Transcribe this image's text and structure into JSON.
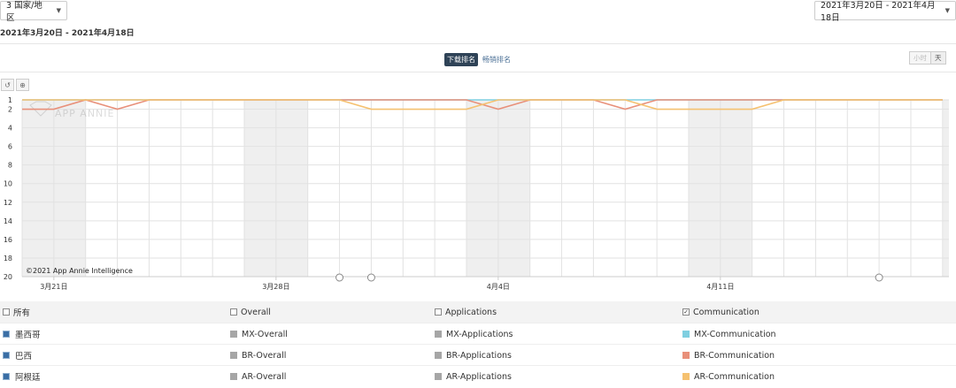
{
  "header": {
    "country_selector": "3 国家/地区",
    "date_range_selector": "2021年3月20日 - 2021年4月18日",
    "date_range_text": "2021年3月20日 - 2021年4月18日"
  },
  "metrics": {
    "download_rank": "下载排名",
    "revenue_rank": "畅销排名"
  },
  "granularity": {
    "hour": "小时",
    "day": "天"
  },
  "chart_data": {
    "type": "line",
    "watermark": "APP ANNIE",
    "copyright": "©2021 App Annie Intelligence",
    "y_ticks": [
      1,
      2,
      4,
      6,
      8,
      10,
      12,
      14,
      16,
      18,
      20
    ],
    "ylim": [
      1,
      20
    ],
    "y_inverted": true,
    "x": [
      "3/20",
      "3/21",
      "3/22",
      "3/23",
      "3/24",
      "3/25",
      "3/26",
      "3/27",
      "3/28",
      "3/29",
      "3/30",
      "3/31",
      "4/1",
      "4/2",
      "4/3",
      "4/4",
      "4/5",
      "4/6",
      "4/7",
      "4/8",
      "4/9",
      "4/10",
      "4/11",
      "4/12",
      "4/13",
      "4/14",
      "4/15",
      "4/16",
      "4/17",
      "4/18"
    ],
    "x_tick_labels": [
      {
        "index": 1,
        "label": "3月21日"
      },
      {
        "index": 8,
        "label": "3月28日"
      },
      {
        "index": 15,
        "label": "4月4日"
      },
      {
        "index": 22,
        "label": "4月11日"
      }
    ],
    "shaded_days": [
      0,
      1,
      7,
      8,
      14,
      15,
      21,
      22,
      29
    ],
    "series": [
      {
        "name": "MX-Communication",
        "color": "#7fcfe0",
        "values": [
          1,
          1,
          1,
          1,
          1,
          1,
          1,
          1,
          1,
          1,
          1,
          1,
          1,
          1,
          1,
          1,
          1,
          1,
          1,
          1,
          1,
          1,
          1,
          1,
          1,
          1,
          1,
          1,
          1,
          1
        ]
      },
      {
        "name": "BR-Communication",
        "color": "#e8907a",
        "values": [
          2,
          2,
          1,
          2,
          1,
          1,
          1,
          1,
          1,
          1,
          1,
          1,
          1,
          1,
          1,
          2,
          1,
          1,
          1,
          2,
          1,
          1,
          1,
          1,
          1,
          1,
          1,
          1,
          1,
          1
        ]
      },
      {
        "name": "AR-Communication",
        "color": "#f5c170",
        "values": [
          1,
          1,
          1,
          1,
          1,
          1,
          1,
          1,
          1,
          1,
          1,
          2,
          2,
          2,
          2,
          1,
          1,
          1,
          1,
          1,
          2,
          2,
          2,
          2,
          1,
          1,
          1,
          1,
          1,
          1
        ]
      }
    ],
    "annotation_markers": [
      10,
      11,
      27
    ]
  },
  "legend": {
    "header": [
      {
        "label": "所有",
        "checked": false
      },
      {
        "label": "Overall",
        "checked": false
      },
      {
        "label": "Applications",
        "checked": false
      },
      {
        "label": "Communication",
        "checked": true
      }
    ],
    "rows": [
      {
        "country": "墨西哥",
        "overall": "MX-Overall",
        "applications": "MX-Applications",
        "communication": "MX-Communication",
        "comm_color": "#7fcfe0"
      },
      {
        "country": "巴西",
        "overall": "BR-Overall",
        "applications": "BR-Applications",
        "communication": "BR-Communication",
        "comm_color": "#e8907a"
      },
      {
        "country": "阿根廷",
        "overall": "AR-Overall",
        "applications": "AR-Applications",
        "communication": "AR-Communication",
        "comm_color": "#f5c170"
      }
    ]
  }
}
